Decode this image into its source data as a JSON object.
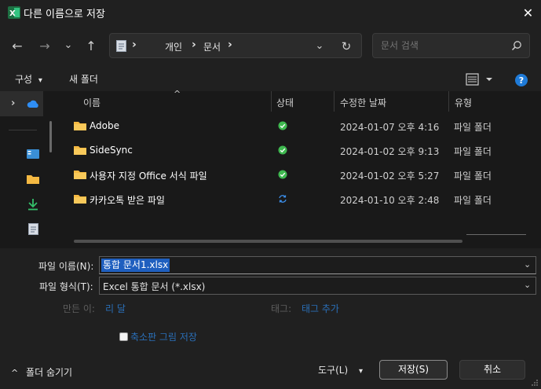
{
  "window": {
    "title": "다른 이름으로 저장",
    "close_glyph": "✕",
    "accent": "#1f7bd8"
  },
  "nav": {
    "back": "←",
    "forward": "→",
    "recent": "⌄",
    "up": "↑",
    "crumbs": [
      "개인",
      "문서"
    ],
    "crumb_sep": "›",
    "dropdown": "⌄",
    "refresh": "↻",
    "search_placeholder": "문서 검색"
  },
  "toolbar": {
    "organize": "구성",
    "organize_caret": "▾",
    "new_folder": "새 폴더",
    "help": "?"
  },
  "columns": {
    "name": "이름",
    "status": "상태",
    "date": "수정한 날짜",
    "type": "유형",
    "sort_glyph": "^"
  },
  "files": [
    {
      "name": "Adobe",
      "status": "synced",
      "date": "2024-01-07 오후 4:16",
      "type": "파일 폴더"
    },
    {
      "name": "SideSync",
      "status": "synced",
      "date": "2024-01-02 오후 9:13",
      "type": "파일 폴더"
    },
    {
      "name": "사용자 지정 Office 서식 파일",
      "status": "synced",
      "date": "2024-01-02 오후 5:27",
      "type": "파일 폴더"
    },
    {
      "name": "카카오톡 받은 파일",
      "status": "syncing",
      "date": "2024-01-10 오후 2:48",
      "type": "파일 폴더"
    }
  ],
  "form": {
    "filename_label": "파일 이름(N):",
    "filename_value": "통합 문서1.xlsx",
    "filetype_label": "파일 형식(T):",
    "filetype_value": "Excel 통합 문서 (*.xlsx)",
    "author_label": "만든 이:",
    "author_value": "리 달",
    "tags_label": "태그:",
    "tags_value": "태그 추가",
    "thumbnail_label": "축소판 그림 저장",
    "arrow": "⌄"
  },
  "footer": {
    "hide_folders": "폴더 숨기기",
    "hide_caret": "^",
    "tools": "도구(L)",
    "tools_caret": "▾",
    "save": "저장(S)",
    "cancel": "취소"
  }
}
